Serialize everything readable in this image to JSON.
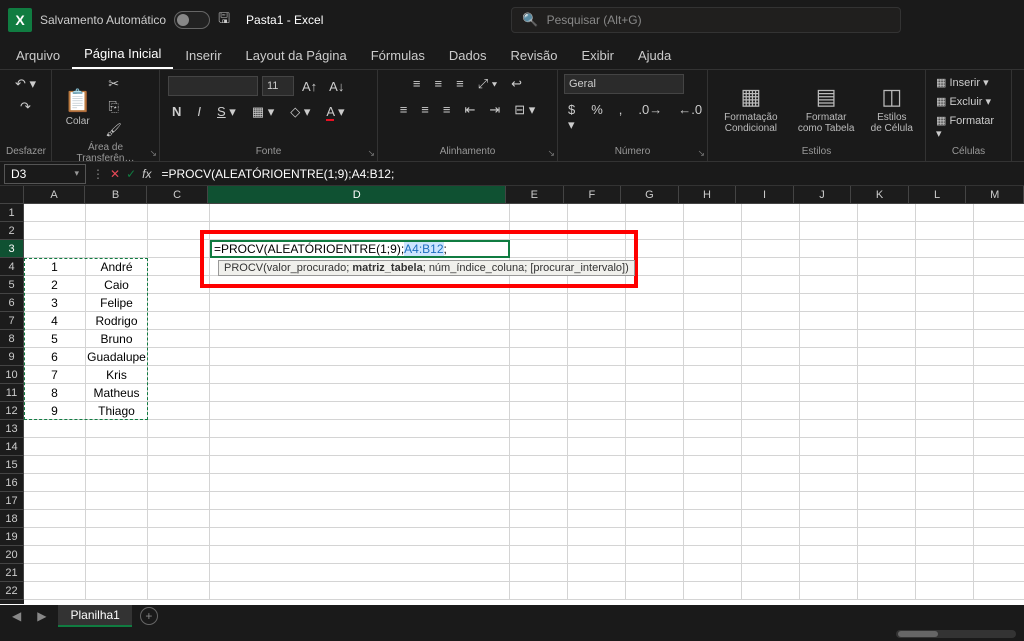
{
  "titlebar": {
    "autosave": "Salvamento Automático",
    "filename": "Pasta1  -  Excel",
    "search_placeholder": "Pesquisar (Alt+G)"
  },
  "tabs": [
    "Arquivo",
    "Página Inicial",
    "Inserir",
    "Layout da Página",
    "Fórmulas",
    "Dados",
    "Revisão",
    "Exibir",
    "Ajuda"
  ],
  "active_tab": "Página Inicial",
  "ribbon": {
    "undo_group": "Desfazer",
    "clipboard_group": "Área de Transferên…",
    "paste": "Colar",
    "font_group": "Fonte",
    "font_name": "",
    "font_size": "11",
    "align_group": "Alinhamento",
    "number_group": "Número",
    "number_format": "Geral",
    "styles_group": "Estilos",
    "cond_fmt": "Formatação Condicional",
    "fmt_table": "Formatar como Tabela",
    "cell_styles": "Estilos de Célula",
    "cells_group": "Células",
    "insert": "Inserir",
    "delete": "Excluir",
    "format": "Formatar"
  },
  "formula_bar": {
    "cell_ref": "D3",
    "formula": "=PROCV(ALEATÓRIOENTRE(1;9);A4:B12;"
  },
  "columns": [
    "A",
    "B",
    "C",
    "D",
    "E",
    "F",
    "G",
    "H",
    "I",
    "J",
    "K",
    "L",
    "M"
  ],
  "rows": 22,
  "data_rows": [
    {
      "a": "1",
      "b": "André"
    },
    {
      "a": "2",
      "b": "Caio"
    },
    {
      "a": "3",
      "b": "Felipe"
    },
    {
      "a": "4",
      "b": "Rodrigo"
    },
    {
      "a": "5",
      "b": "Bruno"
    },
    {
      "a": "6",
      "b": "Guadalupe"
    },
    {
      "a": "7",
      "b": "Kris"
    },
    {
      "a": "8",
      "b": "Matheus"
    },
    {
      "a": "9",
      "b": "Thiago"
    }
  ],
  "editing": {
    "prefix": "=PROCV(ALEATÓRIOENTRE(1;9);",
    "selection": "A4:B12",
    "suffix": ";",
    "hint_fn": "PROCV(",
    "hint_p1": "valor_procurado; ",
    "hint_bold": "matriz_tabela",
    "hint_rest": "; núm_índice_coluna; [procurar_intervalo])"
  },
  "sheet": {
    "name": "Planilha1"
  }
}
